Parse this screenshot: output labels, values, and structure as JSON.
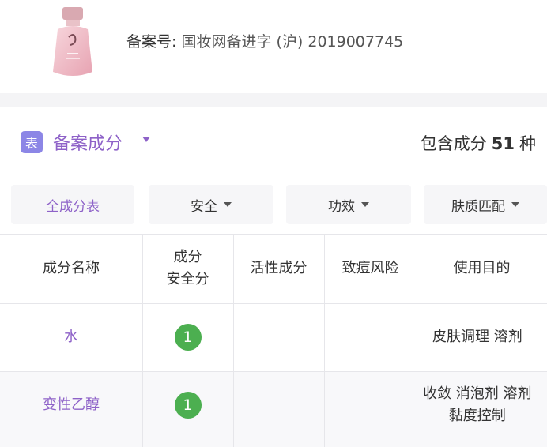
{
  "product": {
    "registration_label": "备案号:",
    "registration_value": "国妆网备进字 (沪) 2019007745"
  },
  "section": {
    "badge": "表",
    "title": "备案成分",
    "count_prefix": "包含成分",
    "count": "51",
    "count_suffix": "种"
  },
  "filters": [
    {
      "label": "全成分表"
    },
    {
      "label": "安全"
    },
    {
      "label": "功效"
    },
    {
      "label": "肤质匹配"
    }
  ],
  "table": {
    "headers": [
      "成分名称",
      "成分\n安全分",
      "活性成分",
      "致痘风险",
      "使用目的"
    ],
    "rows": [
      {
        "name": "水",
        "score": "1",
        "purpose": "皮肤调理 溶剂"
      },
      {
        "name": "变性乙醇",
        "score": "1",
        "purpose": "收敛 消泡剂 溶剂\n黏度控制"
      }
    ]
  },
  "colors": {
    "accent_purple": "#8e62c8",
    "badge_purple": "#8c86e6",
    "score_green": "#4caf50"
  }
}
